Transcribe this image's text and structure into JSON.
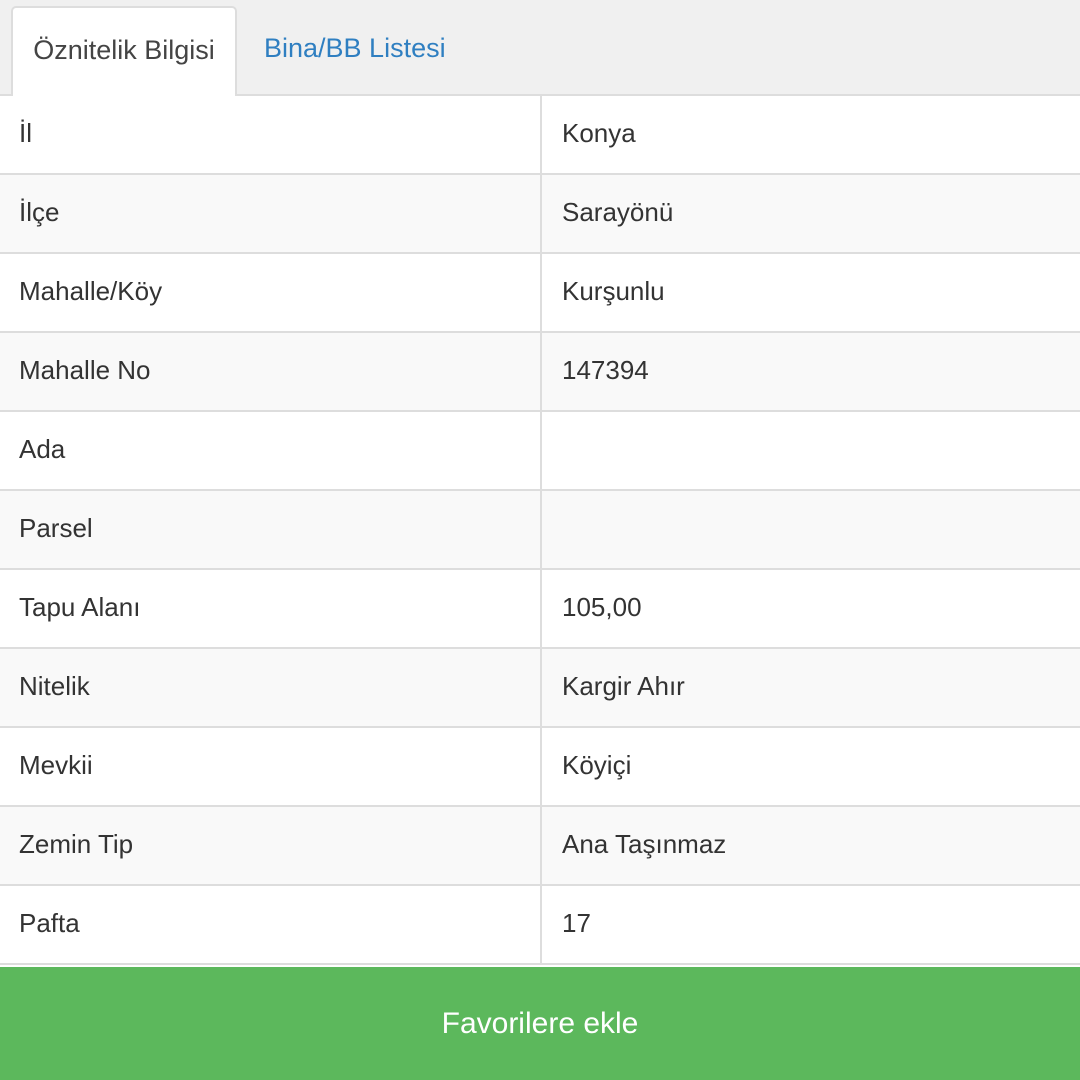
{
  "tabs": [
    {
      "label": "Öznitelik Bilgisi",
      "active": true
    },
    {
      "label": "Bina/BB Listesi",
      "active": false
    }
  ],
  "attributes": [
    {
      "key": "İl",
      "value": "Konya"
    },
    {
      "key": "İlçe",
      "value": "Sarayönü"
    },
    {
      "key": "Mahalle/Köy",
      "value": "Kurşunlu"
    },
    {
      "key": "Mahalle No",
      "value": "147394"
    },
    {
      "key": "Ada",
      "value": ""
    },
    {
      "key": "Parsel",
      "value": ""
    },
    {
      "key": "Tapu Alanı",
      "value": "105,00"
    },
    {
      "key": "Nitelik",
      "value": "Kargir Ahır"
    },
    {
      "key": "Mevkii",
      "value": "Köyiçi"
    },
    {
      "key": "Zemin Tip",
      "value": "Ana Taşınmaz"
    },
    {
      "key": "Pafta",
      "value": "17"
    }
  ],
  "favorites_button": {
    "label": "Favorilere ekle"
  },
  "colors": {
    "accent_green": "#5cb85c",
    "link_blue": "#2f7fc1",
    "border": "#dddddd"
  }
}
